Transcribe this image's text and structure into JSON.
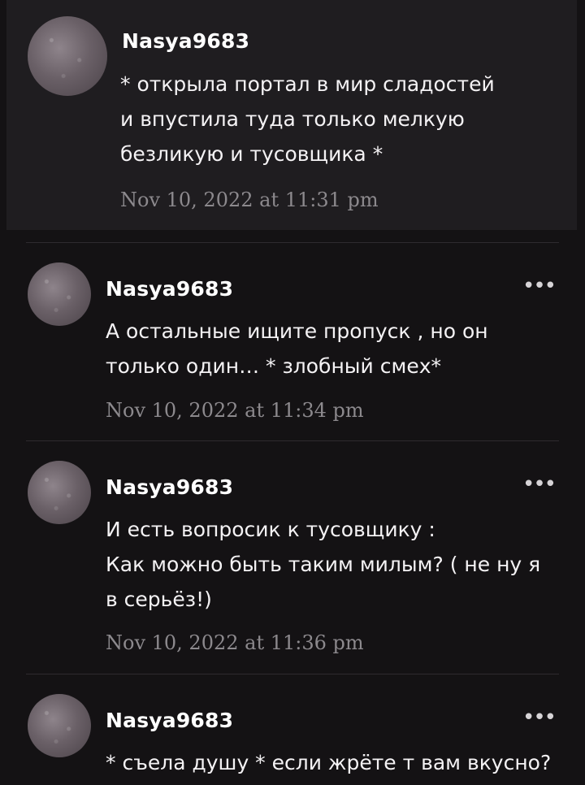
{
  "comments": [
    {
      "username": "Nasya9683",
      "text": "* открыла портал в мир сладостей\nи впустила туда только мелкую\nбезликую и тусовщика *",
      "time": "Nov 10, 2022 at 11:31 pm"
    },
    {
      "username": "Nasya9683",
      "text": "А остальные ищите пропуск , но он\nтолько один… * злобный смех*",
      "time": "Nov 10, 2022 at 11:34 pm",
      "more": "•••"
    },
    {
      "username": "Nasya9683",
      "text": "И есть вопросик к тусовщику :\nКак можно быть таким милым? ( не ну я\nв серьёз!)",
      "time": "Nov 10, 2022 at 11:36 pm",
      "more": "•••"
    },
    {
      "username": "Nasya9683",
      "text": "* съела душу * если жрёте т вам вкусно?",
      "more": "•••"
    }
  ]
}
